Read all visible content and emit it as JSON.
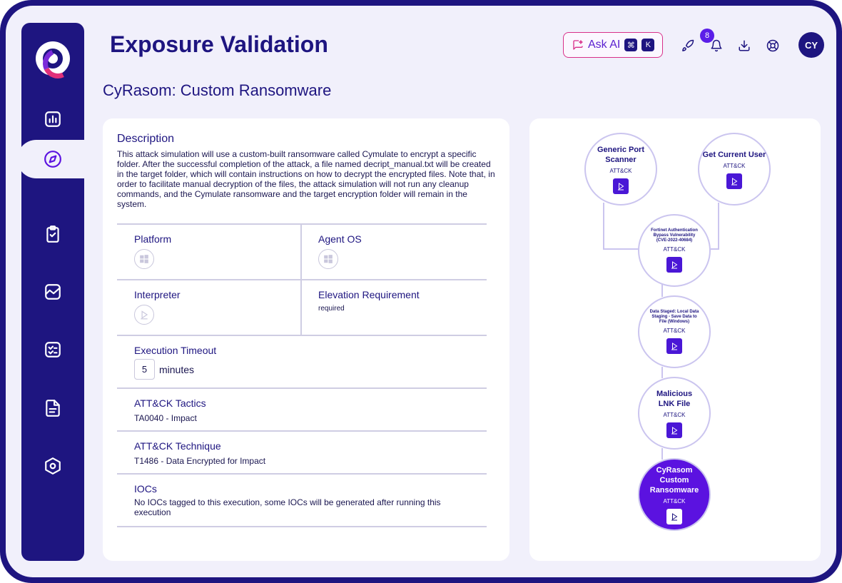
{
  "header": {
    "title": "Exposure Validation",
    "ask_ai_label": "Ask AI",
    "shortcut_mod": "⌘",
    "shortcut_key": "K",
    "notification_count": "8",
    "avatar_initials": "CY"
  },
  "sidebar": {
    "items": [
      {
        "name": "dashboard",
        "icon": "chart-icon"
      },
      {
        "name": "explore",
        "icon": "compass-icon",
        "active": true
      },
      {
        "name": "tasks",
        "icon": "clipboard-check-icon"
      },
      {
        "name": "analytics",
        "icon": "line-chart-icon"
      },
      {
        "name": "checklist",
        "icon": "checklist-icon"
      },
      {
        "name": "documents",
        "icon": "document-icon"
      },
      {
        "name": "settings",
        "icon": "hexagon-settings-icon"
      }
    ]
  },
  "page": {
    "subtitle": "CyRasom: Custom Ransomware"
  },
  "details": {
    "description_label": "Description",
    "description_text": "This attack simulation will use a custom-built ransomware called Cymulate to encrypt a specific folder. After the successful completion of the attack, a file named decript_manual.txt will be created in the target folder, which will contain instructions on how to decrypt the encrypted files. Note that, in order to facilitate manual decryption of the files, the attack simulation will not run any cleanup commands, and the Cymulate ransomware and the target encryption folder will remain in the system.",
    "platform_label": "Platform",
    "agent_os_label": "Agent OS",
    "interpreter_label": "Interpreter",
    "elevation_label": "Elevation Requirement",
    "elevation_value": "required",
    "timeout_label": "Execution Timeout",
    "timeout_value": "5",
    "timeout_unit": "minutes",
    "tactics_label": "ATT&CK Tactics",
    "tactics_value": "TA0040 - Impact",
    "technique_label": "ATT&CK Technique",
    "technique_value": "T1486 - Data Encrypted for Impact",
    "iocs_label": "IOCs",
    "iocs_value": "No IOCs tagged to this execution, some IOCs will be generated after running this execution"
  },
  "flow": {
    "nodes": [
      {
        "title": "Generic Port Scanner",
        "sub": "ATT&CK"
      },
      {
        "title": "Get Current User",
        "sub": "ATT&CK"
      },
      {
        "title": "Fortinet Authentication Bypass Vulnerability (CVE-2022-40684)",
        "sub": "ATT&CK"
      },
      {
        "title": "Data Staged: Local Data Staging - Save Data to File (Windows)",
        "sub": "ATT&CK"
      },
      {
        "title": "Malicious LNK File",
        "sub": "ATT&CK"
      },
      {
        "title": "CyRasom Custom Ransomware",
        "sub": "ATT&CK"
      }
    ]
  },
  "colors": {
    "brand": "#1e1580",
    "accent": "#5b12e0",
    "ai_border": "#d8308a"
  }
}
